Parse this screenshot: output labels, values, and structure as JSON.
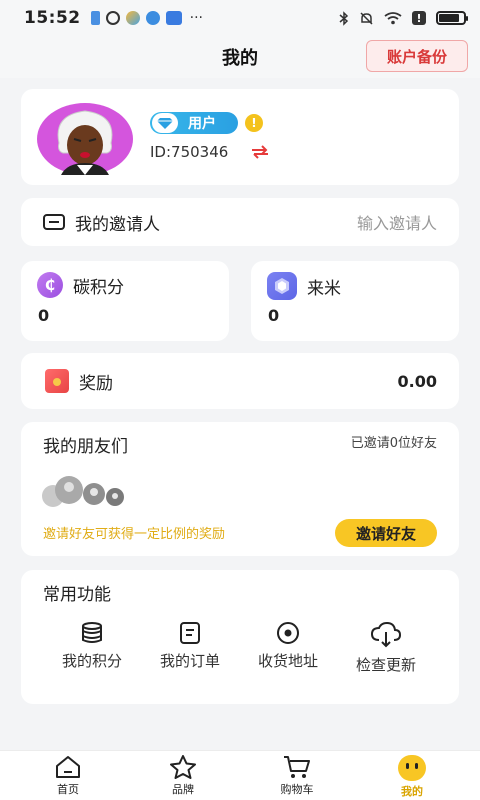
{
  "status_bar": {
    "time": "15:52",
    "battery_level": 0.85,
    "icons": [
      "sim-icon",
      "circle-app-icon",
      "weather-icon",
      "cloud-app-icon",
      "mail-icon",
      "more-dots-icon",
      "bluetooth-icon",
      "mute-icon",
      "wifi-icon",
      "alert-icon",
      "battery-icon"
    ],
    "more": "···"
  },
  "header": {
    "title": "我的",
    "backup_button": "账户备份"
  },
  "profile": {
    "badge_label": "用户",
    "warn_symbol": "!",
    "user_id": "ID:750346"
  },
  "invite": {
    "label": "我的邀请人",
    "placeholder": "输入邀请人"
  },
  "carbon": {
    "label": "碳积分",
    "value": "0",
    "icon_glyph": "₵"
  },
  "laimi": {
    "label": "来米",
    "value": "0"
  },
  "reward": {
    "label": "奖励",
    "value": "0.00"
  },
  "friends": {
    "title": "我的朋友们",
    "count_text": "已邀请0位好友",
    "hint": "邀请好友可获得一定比例的奖励",
    "invite_button": "邀请好友"
  },
  "functions": {
    "title": "常用功能",
    "items": [
      {
        "label": "我的积分",
        "icon": "database-icon"
      },
      {
        "label": "我的订单",
        "icon": "order-icon"
      },
      {
        "label": "收货地址",
        "icon": "location-icon"
      },
      {
        "label": "检查更新",
        "icon": "cloud-download-icon"
      }
    ]
  },
  "tabbar": {
    "items": [
      {
        "label": "首页",
        "icon": "home-icon"
      },
      {
        "label": "品牌",
        "icon": "star-icon"
      },
      {
        "label": "购物车",
        "icon": "cart-icon"
      },
      {
        "label": "我的",
        "icon": "smile-icon",
        "active": true
      }
    ]
  },
  "colors": {
    "accent_yellow": "#f8c624",
    "hint_yellow": "#e0ac16",
    "backup_red": "#d93a3a",
    "badge_blue": "#2aa0e2",
    "purple": "#9b4fe0"
  }
}
